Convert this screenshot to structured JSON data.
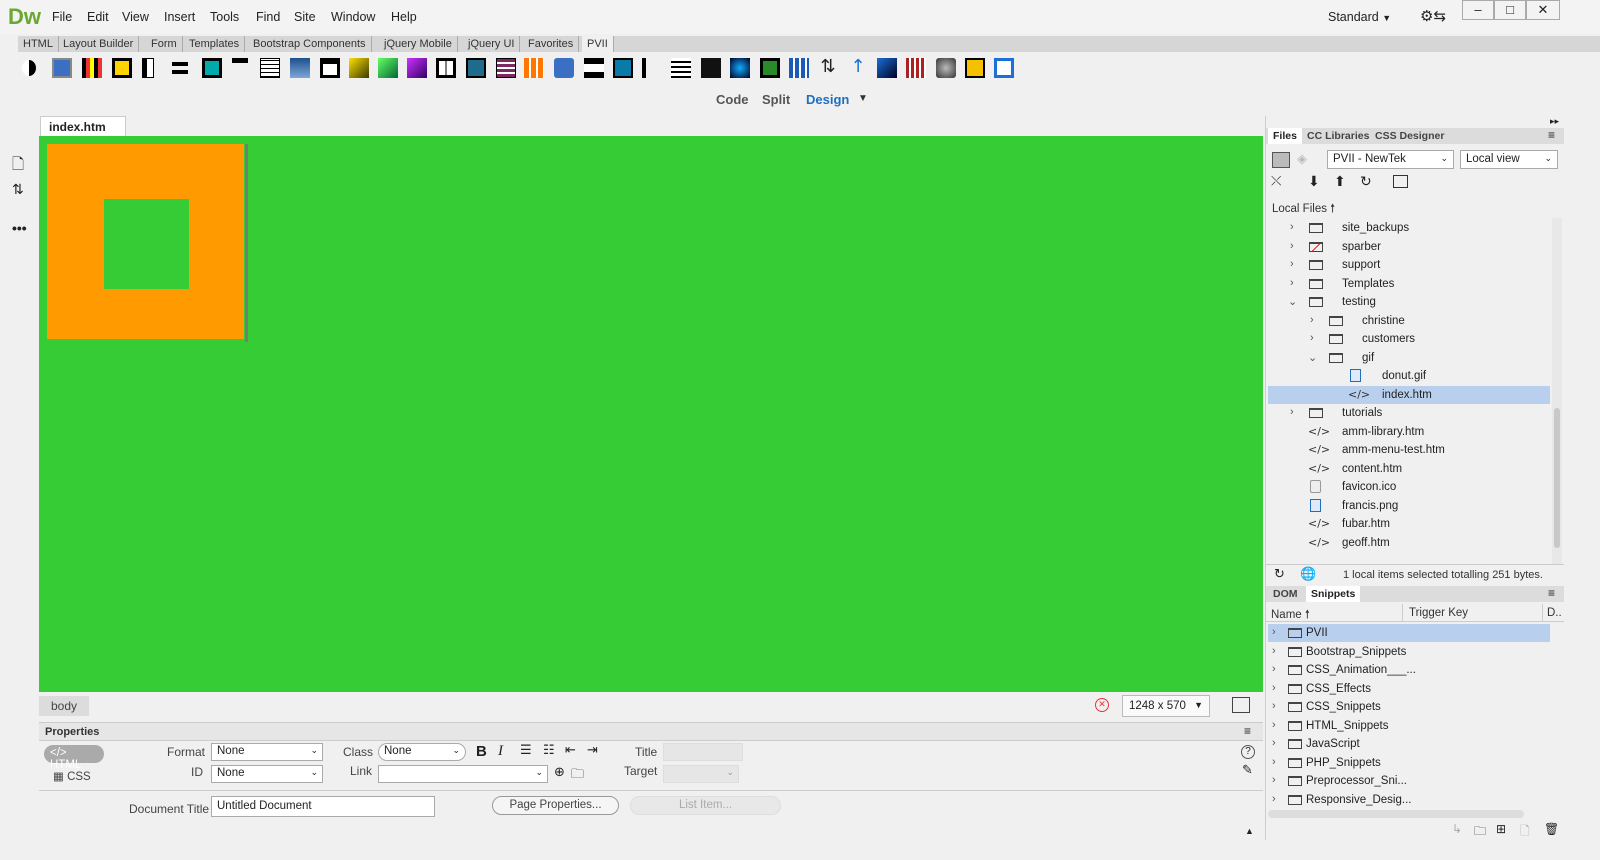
{
  "app": {
    "logo": "Dw"
  },
  "menu": [
    "File",
    "Edit",
    "View",
    "Insert",
    "Tools",
    "Find",
    "Site",
    "Window",
    "Help"
  ],
  "workspace": {
    "layout_label": "Standard"
  },
  "insert_tabs": [
    "HTML",
    "Layout Builder",
    "Form",
    "Templates",
    "Bootstrap Components",
    "jQuery Mobile",
    "jQuery UI",
    "Favorites",
    "PVII"
  ],
  "view_modes": {
    "code": "Code",
    "split": "Split",
    "design": "Design"
  },
  "document": {
    "tab_name": "index.htm",
    "close_glyph": "×",
    "tag_selector": "body",
    "window_size": "1248 x 570"
  },
  "files_panel": {
    "tabs": [
      "Files",
      "CC Libraries",
      "CSS Designer"
    ],
    "site": "PVII - NewTek",
    "view": "Local view",
    "header": "Local Files",
    "items": [
      {
        "name": "site_backups",
        "type": "folder",
        "level": 0,
        "expanded": false
      },
      {
        "name": "sparber",
        "type": "folder-blocked",
        "level": 0,
        "expanded": false
      },
      {
        "name": "support",
        "type": "folder",
        "level": 0,
        "expanded": false
      },
      {
        "name": "Templates",
        "type": "folder",
        "level": 0,
        "expanded": false
      },
      {
        "name": "testing",
        "type": "folder",
        "level": 0,
        "expanded": true
      },
      {
        "name": "christine",
        "type": "folder",
        "level": 1,
        "expanded": false
      },
      {
        "name": "customers",
        "type": "folder",
        "level": 1,
        "expanded": false
      },
      {
        "name": "gif",
        "type": "folder",
        "level": 1,
        "expanded": true
      },
      {
        "name": "donut.gif",
        "type": "image",
        "level": 2
      },
      {
        "name": "index.htm",
        "type": "html",
        "level": 2,
        "selected": true
      },
      {
        "name": "tutorials",
        "type": "folder",
        "level": 0,
        "expanded": false
      },
      {
        "name": "amm-library.htm",
        "type": "html",
        "level": 0
      },
      {
        "name": "amm-menu-test.htm",
        "type": "html",
        "level": 0
      },
      {
        "name": "content.htm",
        "type": "html",
        "level": 0
      },
      {
        "name": "favicon.ico",
        "type": "icon",
        "level": 0
      },
      {
        "name": "francis.png",
        "type": "image",
        "level": 0
      },
      {
        "name": "fubar.htm",
        "type": "html",
        "level": 0
      },
      {
        "name": "geoff.htm",
        "type": "html",
        "level": 0
      }
    ],
    "status": "1 local items selected totalling 251 bytes."
  },
  "snippets_panel": {
    "tabs": [
      "DOM",
      "Snippets"
    ],
    "columns": [
      "Name",
      "Trigger Key",
      "D.."
    ],
    "items": [
      "PVII",
      "Bootstrap_Snippets",
      "CSS_Animation___...",
      "CSS_Effects",
      "CSS_Snippets",
      "HTML_Snippets",
      "JavaScript",
      "PHP_Snippets",
      "Preprocessor_Sni...",
      "Responsive_Desig..."
    ]
  },
  "properties": {
    "title": "Properties",
    "html_label": "HTML",
    "css_label": "CSS",
    "format_label": "Format",
    "format_value": "None",
    "id_label": "ID",
    "id_value": "None",
    "class_label": "Class",
    "class_value": "None",
    "link_label": "Link",
    "title_label": "Title",
    "target_label": "Target",
    "doc_title_label": "Document Title",
    "doc_title_value": "Untitled Document",
    "page_props": "Page Properties...",
    "list_item": "List Item..."
  },
  "colors": {
    "canvas": "#35cc35",
    "box": "#ff9b00",
    "accent": "#1f6fbf",
    "selected_row": "#b8d0ee"
  }
}
